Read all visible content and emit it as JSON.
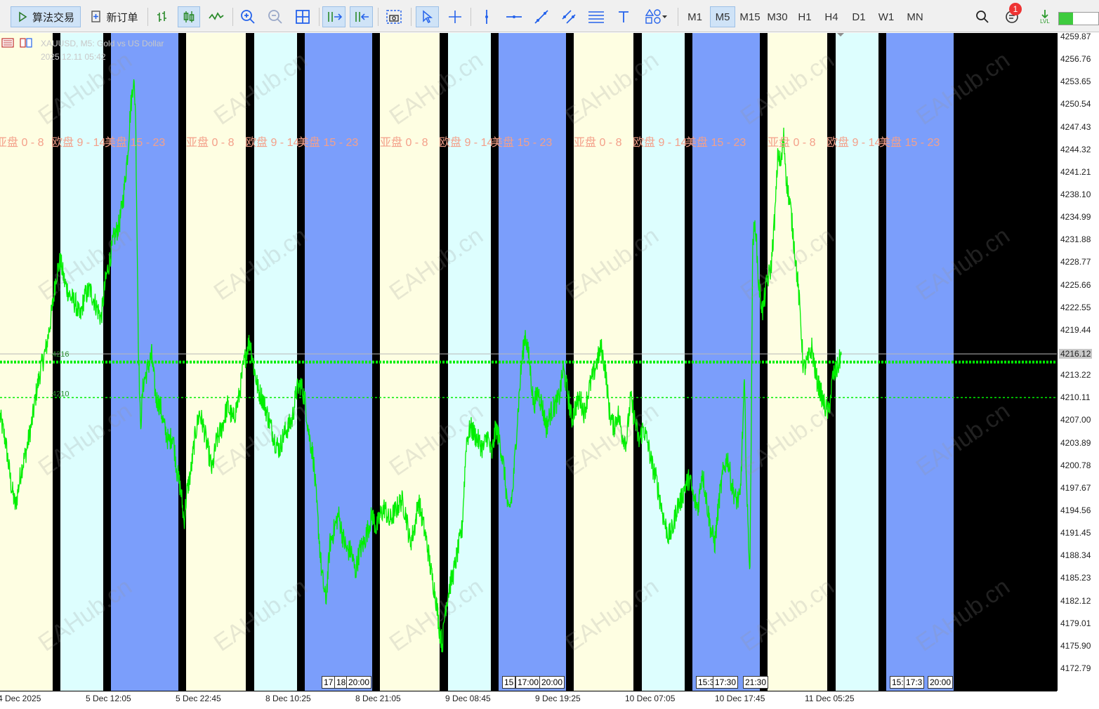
{
  "toolbar": {
    "algo_trading": "算法交易",
    "new_order": "新订单",
    "timeframes": [
      "M1",
      "M5",
      "M15",
      "M30",
      "H1",
      "H4",
      "D1",
      "W1",
      "MN"
    ],
    "active_timeframe": "M5",
    "notification_count": "1",
    "level_label": "LVL"
  },
  "chart": {
    "title": "XAUUSD, M5: Gold vs US Dollar",
    "overlay_time": "2025.12.11 05:42",
    "current_price": "4216.12",
    "line_label_a": "4216",
    "line_label_b": "4210"
  },
  "price_axis": [
    "4259.87",
    "4256.76",
    "4253.65",
    "4250.54",
    "4247.43",
    "4244.32",
    "4241.21",
    "4238.10",
    "4234.99",
    "4231.88",
    "4228.77",
    "4225.66",
    "4222.55",
    "4219.44",
    "4213.22",
    "4210.11",
    "4207.00",
    "4203.89",
    "4200.78",
    "4197.67",
    "4194.56",
    "4191.45",
    "4188.34",
    "4185.23",
    "4182.12",
    "4179.01",
    "4175.90",
    "4172.79"
  ],
  "time_axis": [
    "4 Dec 2025",
    "5 Dec 12:05",
    "5 Dec 22:45",
    "8 Dec 10:25",
    "8 Dec 21:05",
    "9 Dec 08:45",
    "9 Dec 19:25",
    "10 Dec 07:05",
    "10 Dec 17:45",
    "11 Dec 05:25"
  ],
  "session_labels": {
    "asia": "亚盘 0 - 8",
    "europe": "欧盘 9 - 14",
    "us": "美盘 15 - 23"
  },
  "mini_labels": [
    "17",
    "18",
    "20:00",
    "15",
    "17:00",
    "20:00",
    "15:3",
    "17:30",
    "21:30",
    "15:",
    "17:3",
    "20:00"
  ],
  "watermark": "EAHub.cn",
  "colors": {
    "asia": "#fefee2",
    "europe": "#ddfefe",
    "us": "#7b9efb",
    "gap": "#000000",
    "price_line": "#00ee00"
  }
}
